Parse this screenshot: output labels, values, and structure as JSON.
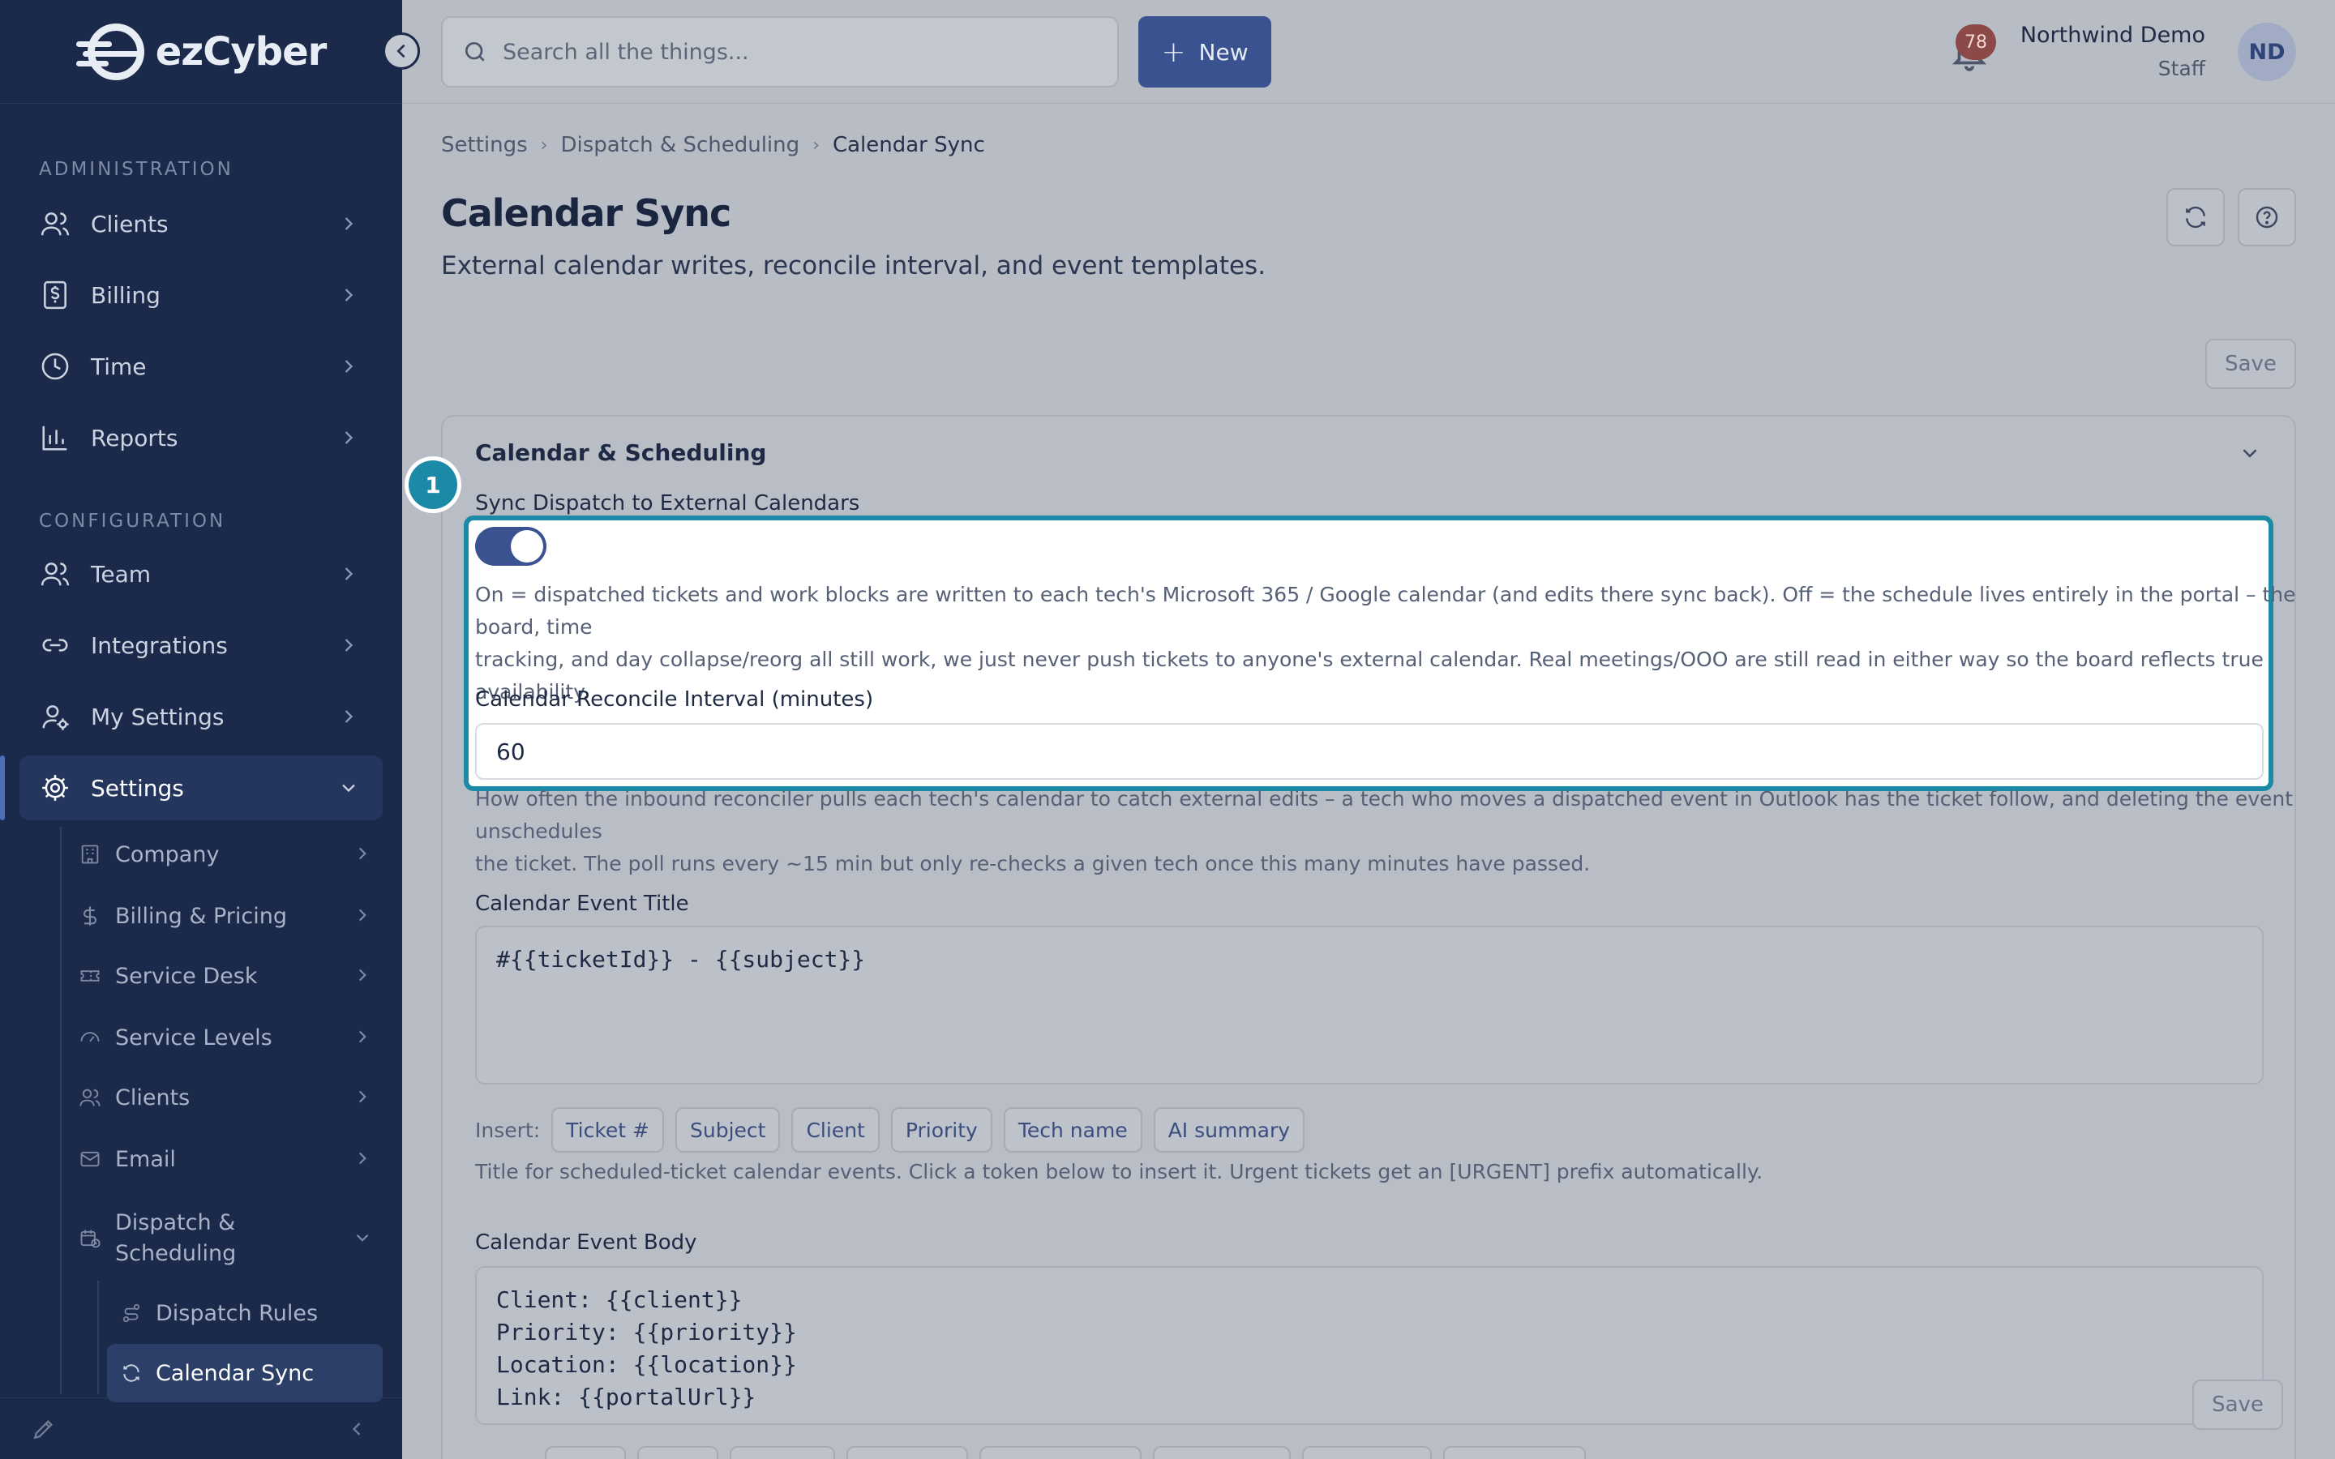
{
  "app": {
    "logo_text": "ezCyber"
  },
  "sidebar": {
    "sections": {
      "administration": "ADMINISTRATION",
      "configuration": "CONFIGURATION"
    },
    "items": [
      {
        "label": "Clients",
        "icon": "users-icon"
      },
      {
        "label": "Billing",
        "icon": "dollar-receipt-icon"
      },
      {
        "label": "Time",
        "icon": "clock-icon"
      },
      {
        "label": "Reports",
        "icon": "bar-chart-icon"
      },
      {
        "label": "Team",
        "icon": "users-icon"
      },
      {
        "label": "Integrations",
        "icon": "link-icon"
      },
      {
        "label": "My Settings",
        "icon": "user-gear-icon"
      },
      {
        "label": "Settings",
        "icon": "gear-icon"
      }
    ],
    "settings_children": [
      {
        "label": "Company",
        "icon": "building-icon"
      },
      {
        "label": "Billing & Pricing",
        "icon": "dollar-icon"
      },
      {
        "label": "Service Desk",
        "icon": "ticket-icon"
      },
      {
        "label": "Service Levels",
        "icon": "gauge-icon"
      },
      {
        "label": "Clients",
        "icon": "users-icon"
      },
      {
        "label": "Email",
        "icon": "mail-icon"
      },
      {
        "label": "Dispatch & Scheduling",
        "label_line1": "Dispatch &",
        "label_line2": "Scheduling",
        "icon": "calendar-clock-icon"
      }
    ],
    "dispatch_children": [
      {
        "label": "Dispatch Rules",
        "icon": "route-icon"
      },
      {
        "label": "Calendar Sync",
        "icon": "refresh-icon"
      }
    ]
  },
  "topbar": {
    "search_placeholder": "Search all the things...",
    "new_label": "New",
    "notification_count": "78",
    "user_name": "Northwind Demo",
    "user_role": "Staff",
    "avatar_initials": "ND"
  },
  "breadcrumb": [
    "Settings",
    "Dispatch & Scheduling",
    "Calendar Sync"
  ],
  "page": {
    "title": "Calendar Sync",
    "subtitle": "External calendar writes, reconcile interval, and event templates.",
    "save_label": "Save"
  },
  "card": {
    "title": "Calendar & Scheduling",
    "callout_number": "1",
    "sync_label": "Sync Dispatch to External Calendars",
    "sync_enabled": true,
    "sync_help_line1": "On = dispatched tickets and work blocks are written to each tech's Microsoft 365 / Google calendar (and edits there sync back). Off = the schedule lives entirely in the portal – the board, time",
    "sync_help_line2": "tracking, and day collapse/reorg all still work, we just never push tickets to anyone's external calendar. Real meetings/OOO are still read in either way so the board reflects true availability.",
    "reconcile_label": "Calendar Reconcile Interval (minutes)",
    "reconcile_value": "60",
    "reconcile_help_line1": "How often the inbound reconciler pulls each tech's calendar to catch external edits – a tech who moves a dispatched event in Outlook has the ticket follow, and deleting the event unschedules",
    "reconcile_help_line2": "the ticket. The poll runs every ~15 min but only re-checks a given tech once this many minutes have passed.",
    "title_label": "Calendar Event Title",
    "title_value": "#{{ticketId}} - {{subject}}",
    "insert_label": "Insert:",
    "tokens": [
      "Ticket #",
      "Subject",
      "Client",
      "Priority",
      "Tech name",
      "AI summary"
    ],
    "title_help": "Title for scheduled-ticket calendar events. Click a token below to insert it. Urgent tickets get an [URGENT] prefix automatically.",
    "body_label": "Calendar Event Body",
    "body_value": "Client: {{client}}\nPriority: {{priority}}\nLocation: {{location}}\nLink: {{portalUrl}}",
    "save_label": "Save"
  }
}
